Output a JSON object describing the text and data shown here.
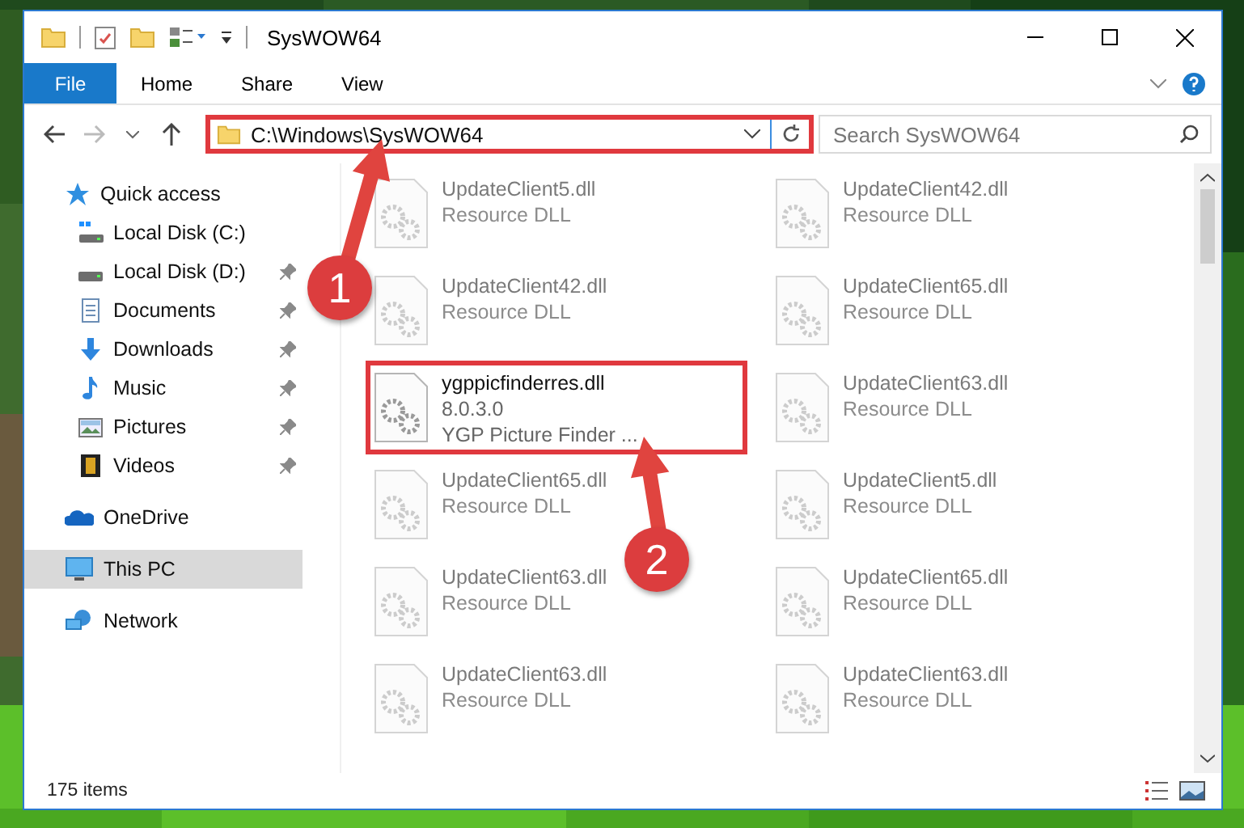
{
  "window": {
    "title": "SysWOW64"
  },
  "ribbon": {
    "tabs": [
      {
        "label": "File",
        "kind": "file"
      },
      {
        "label": "Home",
        "kind": "tab"
      },
      {
        "label": "Share",
        "kind": "tab"
      },
      {
        "label": "View",
        "kind": "tab"
      }
    ]
  },
  "address_bar": {
    "path": "C:\\Windows\\SysWOW64",
    "highlighted": true
  },
  "search": {
    "placeholder": "Search SysWOW64"
  },
  "sidebar": {
    "items": [
      {
        "label": "Quick access",
        "kind": "star",
        "selected": false,
        "children": [
          {
            "label": "Local Disk (C:)",
            "kind": "system-drive",
            "pinned": false,
            "selected": false
          },
          {
            "label": "Local Disk (D:)",
            "kind": "drive",
            "pinned": true,
            "selected": false
          },
          {
            "label": "Documents",
            "kind": "documents",
            "pinned": true,
            "selected": false
          },
          {
            "label": "Downloads",
            "kind": "downloads",
            "pinned": true,
            "selected": false
          },
          {
            "label": "Music",
            "kind": "music",
            "pinned": true,
            "selected": false
          },
          {
            "label": "Pictures",
            "kind": "pictures",
            "pinned": true,
            "selected": false
          },
          {
            "label": "Videos",
            "kind": "videos",
            "pinned": true,
            "selected": false
          }
        ]
      },
      {
        "label": "OneDrive",
        "kind": "cloud",
        "selected": false
      },
      {
        "label": "This PC",
        "kind": "pc",
        "selected": true
      },
      {
        "label": "Network",
        "kind": "network",
        "selected": false
      }
    ]
  },
  "files": [
    {
      "name": "UpdateClient5.dll",
      "detail": "Resource DLL",
      "blurred": true,
      "highlighted": false
    },
    {
      "name": "UpdateClient42.dll",
      "detail": "Resource DLL",
      "blurred": true,
      "highlighted": false
    },
    {
      "name": "UpdateClient42.dll",
      "detail": "Resource DLL",
      "blurred": true,
      "highlighted": false
    },
    {
      "name": "UpdateClient65.dll",
      "detail": "Resource DLL",
      "blurred": true,
      "highlighted": false
    },
    {
      "name": "ygppicfinderres.dll",
      "version": "8.0.3.0",
      "detail": "YGP Picture Finder ...",
      "blurred": false,
      "highlighted": true
    },
    {
      "name": "UpdateClient63.dll",
      "detail": "Resource DLL",
      "blurred": true,
      "highlighted": false
    },
    {
      "name": "UpdateClient65.dll",
      "detail": "Resource DLL",
      "blurred": true,
      "highlighted": false
    },
    {
      "name": "UpdateClient5.dll",
      "detail": "Resource DLL",
      "blurred": true,
      "highlighted": false
    },
    {
      "name": "UpdateClient63.dll",
      "detail": "Resource DLL",
      "blurred": true,
      "highlighted": false
    },
    {
      "name": "UpdateClient65.dll",
      "detail": "Resource DLL",
      "blurred": true,
      "highlighted": false
    },
    {
      "name": "UpdateClient63.dll",
      "detail": "Resource DLL",
      "blurred": true,
      "highlighted": false
    },
    {
      "name": "UpdateClient63.dll",
      "detail": "Resource DLL",
      "blurred": true,
      "highlighted": false
    }
  ],
  "status_bar": {
    "count": "175 items"
  },
  "annotations": [
    {
      "label": "1"
    },
    {
      "label": "2"
    }
  ]
}
